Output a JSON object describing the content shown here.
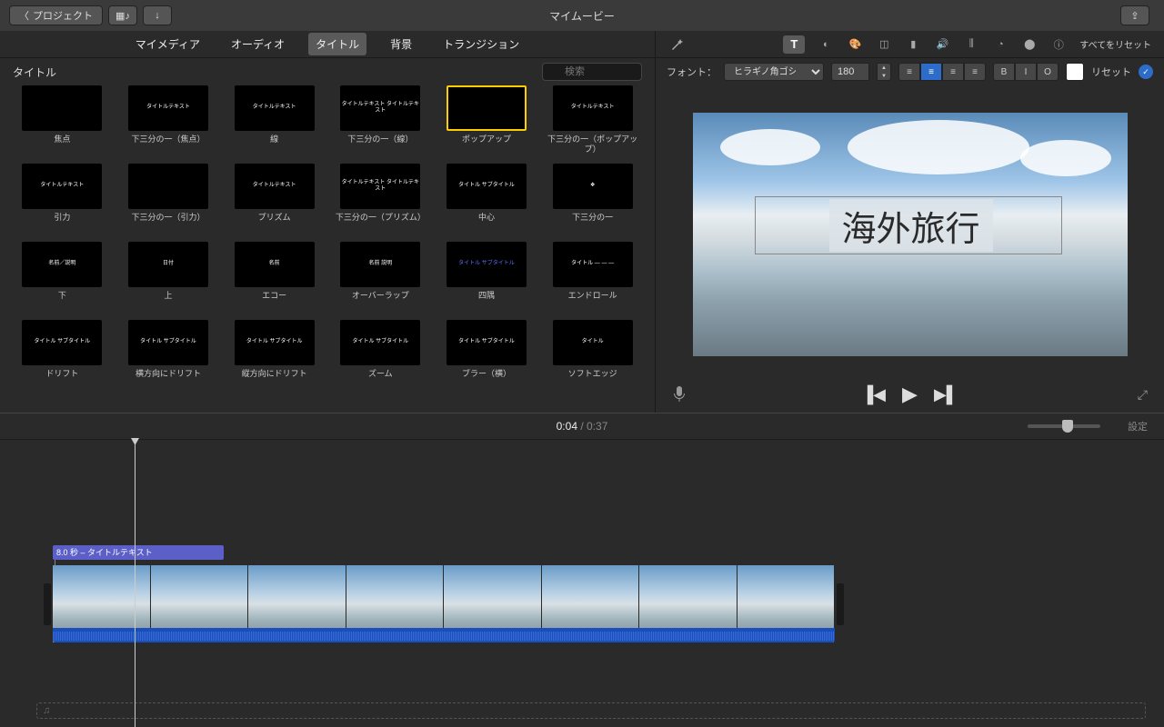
{
  "titlebar": {
    "back": "プロジェクト",
    "title": "マイムービー"
  },
  "media_tabs": [
    "マイメディア",
    "オーディオ",
    "タイトル",
    "背景",
    "トランジション"
  ],
  "media_tabs_active": 2,
  "browser": {
    "label": "タイトル",
    "search_placeholder": "検索"
  },
  "titles": [
    {
      "name": "焦点",
      "preview": ""
    },
    {
      "name": "下三分の一（焦点）",
      "preview": "タイトルテキスト"
    },
    {
      "name": "線",
      "preview": "タイトルテキスト"
    },
    {
      "name": "下三分の一（線）",
      "preview": "タイトルテキスト\nタイトルテキスト"
    },
    {
      "name": "ポップアップ",
      "preview": "",
      "selected": true
    },
    {
      "name": "下三分の一（ポップアップ）",
      "preview": "タイトルテキスト"
    },
    {
      "name": "引力",
      "preview": "タイトルテキスト"
    },
    {
      "name": "下三分の一（引力）",
      "preview": ""
    },
    {
      "name": "プリズム",
      "preview": "タイトルテキスト"
    },
    {
      "name": "下三分の一（プリズム）",
      "preview": "タイトルテキスト\nタイトルテキスト"
    },
    {
      "name": "中心",
      "preview": "タイトル\nサブタイトル"
    },
    {
      "name": "下三分の一",
      "preview": "❖"
    },
    {
      "name": "下",
      "preview": "名前／説明"
    },
    {
      "name": "上",
      "preview": "日付"
    },
    {
      "name": "エコー",
      "preview": "名前"
    },
    {
      "name": "オーバーラップ",
      "preview": "名前 説明"
    },
    {
      "name": "四隅",
      "preview": "タイトル\nサブタイトル"
    },
    {
      "name": "エンドロール",
      "preview": "タイトル\n—\n—\n—"
    },
    {
      "name": "ドリフト",
      "preview": "タイトル\nサブタイトル"
    },
    {
      "name": "横方向にドリフト",
      "preview": "タイトル\nサブタイトル"
    },
    {
      "name": "縦方向にドリフト",
      "preview": "タイトル サブタイトル"
    },
    {
      "name": "ズーム",
      "preview": "タイトル\nサブタイトル"
    },
    {
      "name": "ブラー（横）",
      "preview": "タイトル\nサブタイトル"
    },
    {
      "name": "ソフトエッジ",
      "preview": "タイトル"
    }
  ],
  "inspector": {
    "reset_all": "すべてをリセット"
  },
  "font_bar": {
    "label": "フォント：",
    "family": "ヒラギノ角ゴシック W",
    "size": "180",
    "styles": {
      "b": "B",
      "i": "I",
      "o": "O"
    },
    "reset": "リセット"
  },
  "preview_title": "海外旅行",
  "time": {
    "current": "0:04",
    "total": "0:37"
  },
  "settings": "設定",
  "title_clip": "8.0 秒 – タイトルテキスト",
  "music_icon": "♫"
}
